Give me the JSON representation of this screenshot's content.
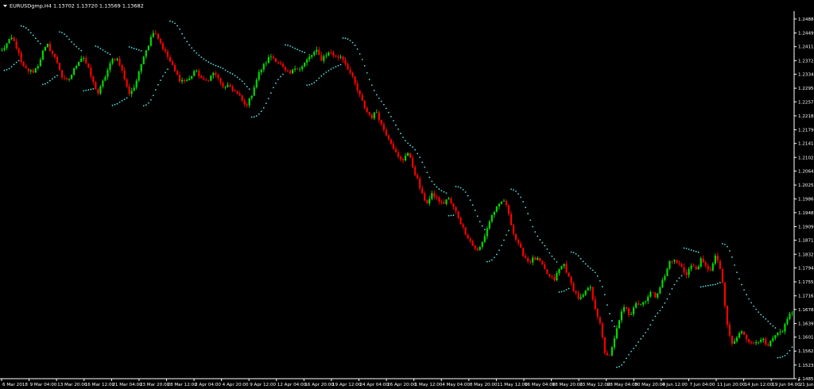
{
  "window": {
    "symbol_label": "EURUSDgmp,H4  1.13702 1.13720 1.13569 1.13682",
    "menu_icon": "triangle-down-icon"
  },
  "colors": {
    "background": "#000000",
    "bull": "#00e000",
    "bear": "#ff0000",
    "sar": "#55dddd",
    "axis": "#ffffff"
  },
  "chart_data": {
    "type": "candlestick",
    "symbol": "EURUSDgmp",
    "timeframe": "H4",
    "ohlc_header": {
      "open": 1.13702,
      "high": 1.1372,
      "low": 1.13569,
      "close": 1.13682
    },
    "y_ticks": [
      1.2488,
      1.2449,
      1.2411,
      1.2372,
      1.2334,
      1.2295,
      1.2257,
      1.2218,
      1.2179,
      1.2141,
      1.2102,
      1.2064,
      1.2025,
      1.1986,
      1.1948,
      1.1909,
      1.1871,
      1.1832,
      1.1794,
      1.1755,
      1.1716,
      1.1678,
      1.1639,
      1.1601,
      1.1562,
      1.1523,
      1.1485
    ],
    "y_tick_labels": [
      "1.24880",
      "1.24490",
      "1.24110",
      "1.23720",
      "1.23340",
      "1.22950",
      "1.22570",
      "1.22180",
      "1.21790",
      "1.21410",
      "1.21020",
      "1.20640",
      "1.20250",
      "1.19860",
      "1.19480",
      "1.19090",
      "1.18710",
      "1.18320",
      "1.17940",
      "1.17550",
      "1.17160",
      "1.16780",
      "1.16390",
      "1.16010",
      "1.15620",
      "1.15230",
      "1.14850"
    ],
    "ylim": [
      1.1485,
      1.251
    ],
    "x_tick_labels": [
      "6 Mar 2018",
      "9 Mar 04:00",
      "13 Mar 20:00",
      "16 Mar 12:00",
      "21 Mar 04:00",
      "23 Mar 20:00",
      "28 Mar 12:00",
      "2 Apr 04:00",
      "4 Apr 20:00",
      "9 Apr 12:00",
      "12 Apr 04:00",
      "16 Apr 20:00",
      "19 Apr 12:00",
      "24 Apr 04:00",
      "26 Apr 20:00",
      "1 May 12:00",
      "4 May 04:00",
      "8 May 20:00",
      "11 May 12:00",
      "16 May 04:00",
      "18 May 20:00",
      "23 May 12:00",
      "28 May 04:00",
      "30 May 20:00",
      "4 Jun 12:00",
      "7 Jun 04:00",
      "11 Jun 20:00",
      "14 Jun 12:00",
      "19 Jun 04:00",
      "21 Jun 20:00"
    ],
    "close_path": [
      1.24,
      1.242,
      1.2435,
      1.2405,
      1.2355,
      1.2345,
      1.234,
      1.2355,
      1.2395,
      1.2415,
      1.239,
      1.2365,
      1.232,
      1.2315,
      1.234,
      1.237,
      1.2385,
      1.235,
      1.231,
      1.228,
      1.2315,
      1.235,
      1.238,
      1.2375,
      1.233,
      1.228,
      1.2295,
      1.2335,
      1.239,
      1.242,
      1.246,
      1.243,
      1.24,
      1.2375,
      1.2345,
      1.232,
      1.2315,
      1.232,
      1.2345,
      1.233,
      1.231,
      1.2325,
      1.234,
      1.231,
      1.2295,
      1.23,
      1.2285,
      1.227,
      1.2245,
      1.2265,
      1.231,
      1.2345,
      1.2365,
      1.2385,
      1.2375,
      1.236,
      1.234,
      1.2335,
      1.2355,
      1.235,
      1.237,
      1.2385,
      1.24,
      1.2375,
      1.239,
      1.2395,
      1.238,
      1.2385,
      1.236,
      1.233,
      1.2295,
      1.226,
      1.223,
      1.2215,
      1.223,
      1.219,
      1.2165,
      1.214,
      1.2105,
      1.209,
      1.212,
      1.208,
      1.204,
      1.1995,
      1.1975,
      1.2,
      1.1985,
      1.197,
      1.199,
      1.1965,
      1.194,
      1.1905,
      1.188,
      1.1855,
      1.184,
      1.187,
      1.1915,
      1.195,
      1.1965,
      1.1985,
      1.195,
      1.189,
      1.1855,
      1.183,
      1.181,
      1.182,
      1.1815,
      1.179,
      1.177,
      1.176,
      1.179,
      1.1805,
      1.176,
      1.173,
      1.1705,
      1.172,
      1.1745,
      1.169,
      1.164,
      1.156,
      1.1545,
      1.16,
      1.166,
      1.1685,
      1.166,
      1.17,
      1.169,
      1.1705,
      1.1725,
      1.1715,
      1.1745,
      1.1775,
      1.182,
      1.181,
      1.18,
      1.1775,
      1.18,
      1.179,
      1.1815,
      1.1795,
      1.179,
      1.183,
      1.178,
      1.165,
      1.158,
      1.1595,
      1.162,
      1.16,
      1.158,
      1.159,
      1.16,
      1.157,
      1.159,
      1.161,
      1.161,
      1.1655,
      1.167
    ]
  }
}
